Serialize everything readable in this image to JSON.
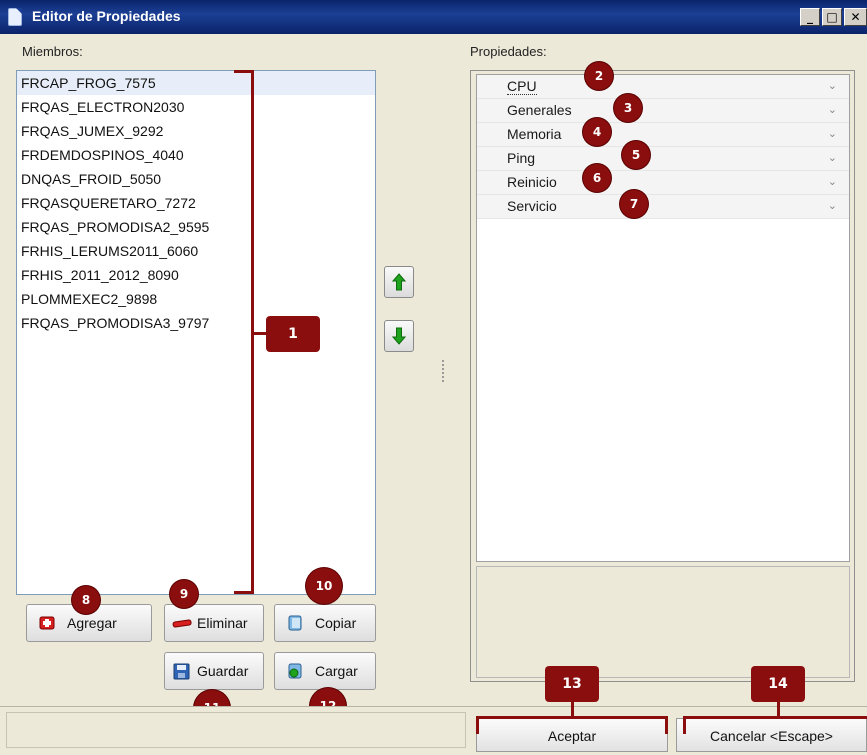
{
  "window": {
    "title": "Editor de Propiedades",
    "controls": [
      "_",
      "□",
      "✕"
    ]
  },
  "members": {
    "label": "Miembros:",
    "items": [
      "FRCAP_FROG_7575",
      "FRQAS_ELECTRON2030",
      "FRQAS_JUMEX_9292",
      "FRDEMDOSPINOS_4040",
      "DNQAS_FROID_5050",
      "FRQASQUERETARO_7272",
      "FRQAS_PROMODISA2_9595",
      "FRHIS_LERUMS2011_6060",
      "FRHIS_2011_2012_8090",
      "PLOMMEXEC2_9898",
      "FRQAS_PROMODISA3_9797"
    ]
  },
  "properties": {
    "label": "Propiedades:",
    "rows": [
      "CPU",
      "Generales",
      "Memoria",
      "Ping",
      "Reinicio",
      "Servicio"
    ]
  },
  "buttons": {
    "agregar": "Agregar",
    "eliminar": "Eliminar",
    "copiar": "Copiar",
    "guardar": "Guardar",
    "cargar": "Cargar",
    "aceptar": "Aceptar",
    "cancelar": "Cancelar <Escape>"
  },
  "callouts": [
    "1",
    "2",
    "3",
    "4",
    "5",
    "6",
    "7",
    "8",
    "9",
    "10",
    "11",
    "12",
    "13",
    "14"
  ],
  "colors": {
    "callout": "#8a0e0e",
    "titlebar": "#0a246a",
    "arrow_green": "#1fa31f"
  }
}
